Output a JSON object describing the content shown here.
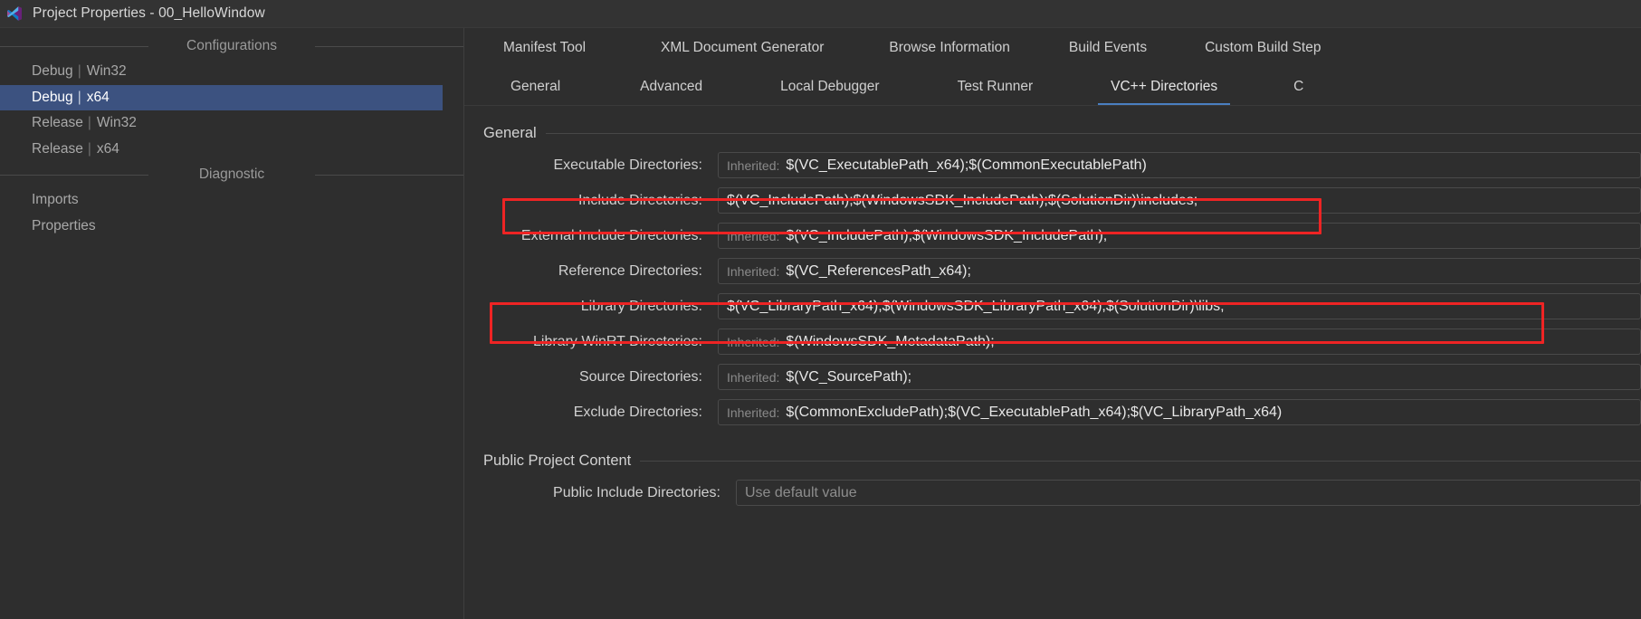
{
  "window": {
    "title": "Project Properties - 00_HelloWindow",
    "icon": "visual-studio-icon",
    "accent_blue": "#4a7fc1",
    "selection_blue": "#3c5280",
    "annotation_red": "#ee2424"
  },
  "sidebar": {
    "groups": [
      {
        "header": "Configurations",
        "items": [
          {
            "config": "Debug",
            "platform": "Win32",
            "selected": false
          },
          {
            "config": "Debug",
            "platform": "x64",
            "selected": true
          },
          {
            "config": "Release",
            "platform": "Win32",
            "selected": false
          },
          {
            "config": "Release",
            "platform": "x64",
            "selected": false
          }
        ]
      },
      {
        "header": "Diagnostic",
        "items": [
          {
            "config": "Imports",
            "platform": "",
            "selected": false
          },
          {
            "config": "Properties",
            "platform": "",
            "selected": false
          }
        ]
      }
    ],
    "separator": "|"
  },
  "tabs": {
    "row1": [
      {
        "label": "Manifest Tool",
        "active": false
      },
      {
        "label": "XML Document Generator",
        "active": false
      },
      {
        "label": "Browse Information",
        "active": false
      },
      {
        "label": "Build Events",
        "active": false
      },
      {
        "label": "Custom Build Step",
        "active": false
      }
    ],
    "row2": [
      {
        "label": "General",
        "active": false
      },
      {
        "label": "Advanced",
        "active": false
      },
      {
        "label": "Local Debugger",
        "active": false
      },
      {
        "label": "Test Runner",
        "active": false
      },
      {
        "label": "VC++ Directories",
        "active": true
      },
      {
        "label": "C",
        "active": false
      }
    ]
  },
  "sections": [
    {
      "title": "General",
      "rows": [
        {
          "label": "Executable Directories:",
          "inherited_prefix": "Inherited:",
          "value": "$(VC_ExecutablePath_x64);$(CommonExecutablePath)",
          "placeholder": "",
          "highlighted": false
        },
        {
          "label": "Include Directories:",
          "inherited_prefix": "",
          "value": "$(VC_IncludePath);$(WindowsSDK_IncludePath);$(SolutionDir)\\includes;",
          "placeholder": "",
          "highlighted": true
        },
        {
          "label": "External Include Directories:",
          "inherited_prefix": "Inherited:",
          "value": "$(VC_IncludePath);$(WindowsSDK_IncludePath);",
          "placeholder": "",
          "highlighted": false
        },
        {
          "label": "Reference Directories:",
          "inherited_prefix": "Inherited:",
          "value": "$(VC_ReferencesPath_x64);",
          "placeholder": "",
          "highlighted": false
        },
        {
          "label": "Library Directories:",
          "inherited_prefix": "",
          "value": "$(VC_LibraryPath_x64);$(WindowsSDK_LibraryPath_x64);$(SolutionDir)\\libs;",
          "placeholder": "",
          "highlighted": true
        },
        {
          "label": "Library WinRT Directories:",
          "inherited_prefix": "Inherited:",
          "value": "$(WindowsSDK_MetadataPath);",
          "placeholder": "",
          "highlighted": false
        },
        {
          "label": "Source Directories:",
          "inherited_prefix": "Inherited:",
          "value": "$(VC_SourcePath);",
          "placeholder": "",
          "highlighted": false
        },
        {
          "label": "Exclude Directories:",
          "inherited_prefix": "Inherited:",
          "value": "$(CommonExcludePath);$(VC_ExecutablePath_x64);$(VC_LibraryPath_x64)",
          "placeholder": "",
          "highlighted": false
        }
      ]
    },
    {
      "title": "Public Project Content",
      "rows": [
        {
          "label": "Public Include Directories:",
          "inherited_prefix": "",
          "value": "",
          "placeholder": "Use default value",
          "highlighted": false
        }
      ]
    }
  ]
}
